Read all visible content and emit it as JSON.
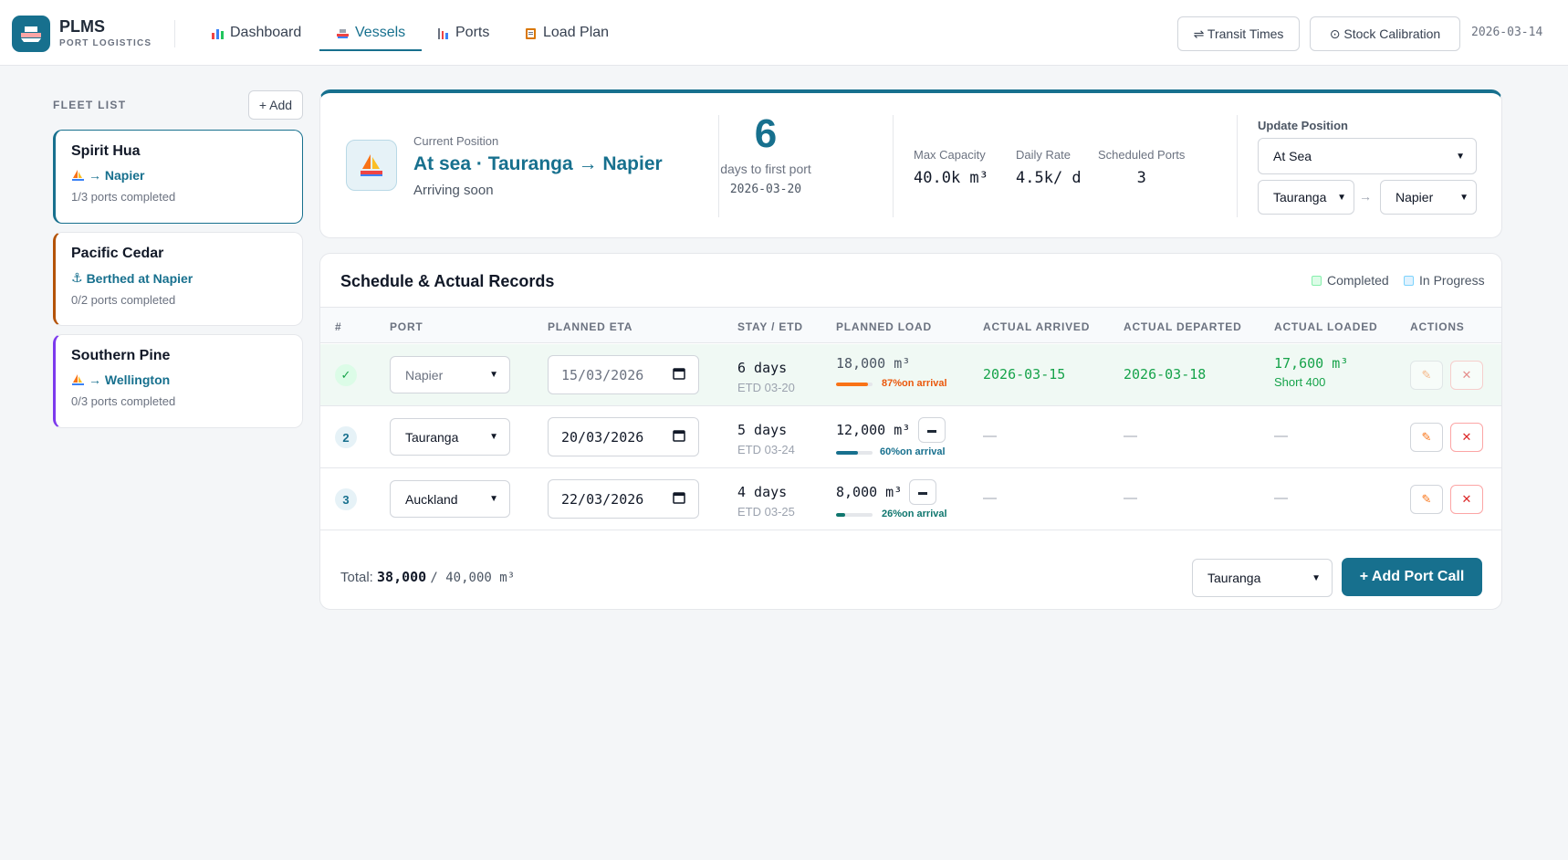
{
  "app": {
    "name": "PLMS",
    "subtitle": "PORT LOGISTICS"
  },
  "nav": [
    {
      "label": "Dashboard",
      "icon": "chart-icon"
    },
    {
      "label": "Vessels",
      "icon": "ship-icon",
      "active": true
    },
    {
      "label": "Ports",
      "icon": "port-icon"
    },
    {
      "label": "Load Plan",
      "icon": "clipboard-icon"
    }
  ],
  "header": {
    "transit_label": "⇌ Transit Times",
    "calibration_label": "⊙ Stock Calibration",
    "date": "2026-03-14"
  },
  "fleet": {
    "title": "FLEET LIST",
    "add_label": "+ Add",
    "vessels": [
      {
        "name": "Spirit Hua",
        "status": "→ Napier",
        "progress": "1/3 ports completed",
        "icon": "sailboat-icon",
        "accent": "#17708e",
        "selected": true
      },
      {
        "name": "Pacific Cedar",
        "status": "Berthed at Napier",
        "progress": "0/2 ports completed",
        "icon": "anchor-icon",
        "accent": "#b45309"
      },
      {
        "name": "Southern Pine",
        "status": "→ Wellington",
        "progress": "0/3 ports completed",
        "icon": "sailboat-icon",
        "accent": "#7c3aed"
      }
    ]
  },
  "position": {
    "label": "Current Position",
    "main": "At sea · Tauranga → Napier",
    "sub": "Arriving soon",
    "days": "6",
    "days_label": "days to first port",
    "days_date": "2026-03-20",
    "stats": [
      {
        "label": "Max Capacity",
        "value": "40.0k m³"
      },
      {
        "label": "Daily Rate",
        "value": "4.5k/ d"
      },
      {
        "label": "Scheduled Ports",
        "value": "3"
      }
    ],
    "update_label": "Update Position",
    "status_select": "At Sea",
    "from_select": "Tauranga",
    "to_select": "Napier",
    "arrow": "→"
  },
  "schedule": {
    "title": "Schedule & Actual Records",
    "legend": [
      {
        "label": "Completed",
        "color": "#dcfce7"
      },
      {
        "label": "In Progress",
        "color": "#e0f2fe"
      }
    ],
    "headers": [
      "#",
      "PORT",
      "PLANNED ETA",
      "STAY / ETD",
      "PLANNED LOAD",
      "ACTUAL ARRIVED",
      "ACTUAL DEPARTED",
      "ACTUAL LOADED",
      "ACTIONS"
    ],
    "rows": [
      {
        "num": "✓",
        "port": "Napier",
        "eta": "15/03/2026",
        "stay": "6 days",
        "etd": "ETD 03-20",
        "load": "18,000 m³",
        "pct": 87,
        "pct_text": "87%on arrival",
        "arrived": "2026-03-15",
        "departed": "2026-03-18",
        "loaded": "17,600 m³",
        "loaded_note": "Short 400",
        "completed": true
      },
      {
        "num": "2",
        "port": "Tauranga",
        "eta": "20/03/2026",
        "stay": "5 days",
        "etd": "ETD 03-24",
        "load": "12,000 m³",
        "pct": 60,
        "pct_text": "60%on arrival",
        "arrived": "—",
        "departed": "—",
        "loaded": "—"
      },
      {
        "num": "3",
        "port": "Auckland",
        "eta": "22/03/2026",
        "stay": "4 days",
        "etd": "ETD 03-25",
        "load": "8,000 m³",
        "pct": 26,
        "pct_text": "26%on arrival",
        "arrived": "—",
        "departed": "—",
        "loaded": "—"
      }
    ],
    "total_label": "Total:",
    "total_value": "38,000",
    "total_cap": "/ 40,000 m³",
    "add_port_select": "Tauranga",
    "add_port_label": "+ Add Port Call"
  }
}
